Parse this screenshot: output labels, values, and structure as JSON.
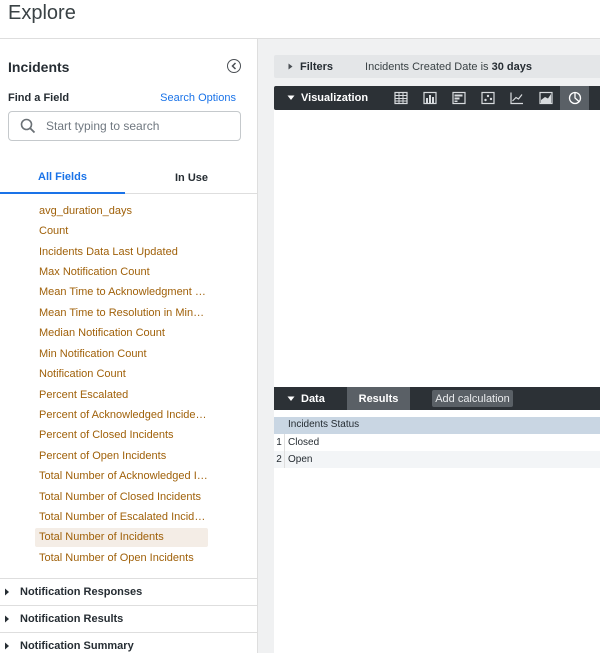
{
  "header": {
    "title": "Explore"
  },
  "sidebar": {
    "title": "Incidents",
    "find_label": "Find a Field",
    "search_options_label": "Search Options",
    "search_placeholder": "Start typing to search",
    "tabs": [
      {
        "label": "All Fields",
        "active": true
      },
      {
        "label": "In Use",
        "active": false
      }
    ],
    "fields": [
      {
        "label": "avg_duration_days"
      },
      {
        "label": "Count"
      },
      {
        "label": "Incidents Data Last Updated"
      },
      {
        "label": "Max Notification Count"
      },
      {
        "label": "Mean Time to Acknowledgment in ..."
      },
      {
        "label": "Mean Time to Resolution in Minutes..."
      },
      {
        "label": "Median Notification Count"
      },
      {
        "label": "Min Notification Count"
      },
      {
        "label": "Notification Count"
      },
      {
        "label": "Percent Escalated"
      },
      {
        "label": "Percent of Acknowledged Incidents"
      },
      {
        "label": "Percent of Closed Incidents"
      },
      {
        "label": "Percent of Open Incidents"
      },
      {
        "label": "Total Number of Acknowledged Inci..."
      },
      {
        "label": "Total Number of Closed Incidents"
      },
      {
        "label": "Total Number of Escalated Incidents"
      },
      {
        "label": "Total Number of Incidents",
        "selected": true
      },
      {
        "label": "Total Number of Open Incidents"
      }
    ],
    "groups": [
      {
        "label": "Notification Responses"
      },
      {
        "label": "Notification Results"
      },
      {
        "label": "Notification Summary"
      }
    ]
  },
  "main": {
    "filters": {
      "label": "Filters",
      "summary_field": "Incidents Created Date",
      "summary_op": "is",
      "summary_value": "30 days"
    },
    "visualization": {
      "label": "Visualization",
      "icons": [
        "table-icon",
        "column-chart-icon",
        "bar-chart-icon",
        "scatter-icon",
        "line-chart-icon",
        "area-chart-icon",
        "pie-chart-icon"
      ],
      "active_icon": "pie-chart-icon"
    },
    "data": {
      "label": "Data",
      "results_label": "Results",
      "add_calc_label": "Add calculation",
      "column_header": "Incidents Status",
      "rows": [
        {
          "index": "1",
          "value": "Closed"
        },
        {
          "index": "2",
          "value": "Open"
        }
      ]
    }
  },
  "colors": {
    "accent": "#1a73e8",
    "field_text": "#a0610a",
    "dark_bar": "#2c3136",
    "selected_field_bg": "#f4ede6"
  }
}
